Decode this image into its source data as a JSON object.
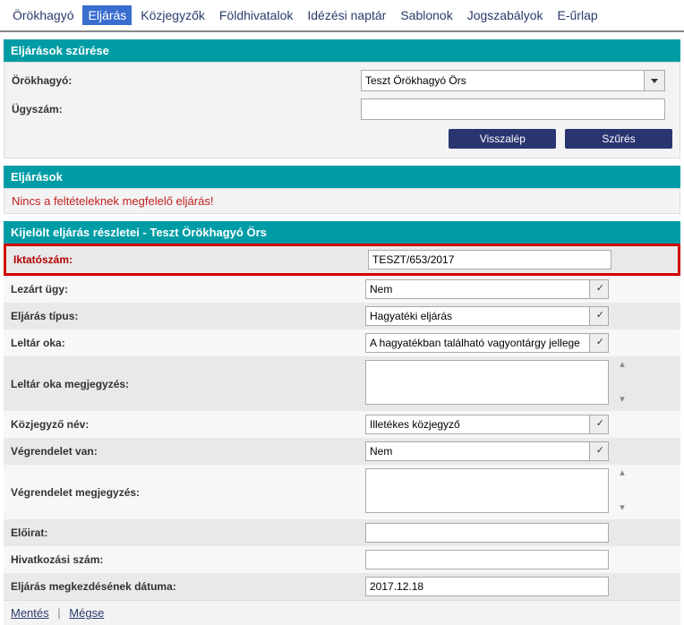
{
  "nav": {
    "items": [
      {
        "label": "Örökhagyó",
        "active": false
      },
      {
        "label": "Eljárás",
        "active": true
      },
      {
        "label": "Közjegyzők",
        "active": false
      },
      {
        "label": "Földhivatalok",
        "active": false
      },
      {
        "label": "Idézési naptár",
        "active": false
      },
      {
        "label": "Sablonok",
        "active": false
      },
      {
        "label": "Jogszabályok",
        "active": false
      },
      {
        "label": "E-űrlap",
        "active": false
      }
    ]
  },
  "filter": {
    "title": "Eljárások szűrése",
    "orokhagyo_label": "Örökhagyó:",
    "orokhagyo_value": "Teszt Örökhagyó Örs",
    "ugyszam_label": "Ügyszám:",
    "ugyszam_value": "",
    "btn_back": "Visszalép",
    "btn_filter": "Szűrés"
  },
  "list": {
    "title": "Eljárások",
    "empty_msg": "Nincs a feltételeknek megfelelő eljárás!"
  },
  "detail": {
    "title": "Kijelölt eljárás részletei - Teszt Örökhagyó Örs",
    "rows": {
      "iktatoszam_label": "Iktatószám:",
      "iktatoszam_value": "TESZT/653/2017",
      "lezart_label": "Lezárt ügy:",
      "lezart_value": "Nem",
      "tipus_label": "Eljárás típus:",
      "tipus_value": "Hagyatéki eljárás",
      "leltar_oka_label": "Leltár oka:",
      "leltar_oka_value": "A hagyatékban található vagyontárgy jellege",
      "leltar_megj_label": "Leltár oka megjegyzés:",
      "leltar_megj_value": "",
      "kozjegyzo_label": "Közjegyző név:",
      "kozjegyzo_value": "Illetékes közjegyző",
      "vegrendelet_label": "Végrendelet van:",
      "vegrendelet_value": "Nem",
      "vegrendelet_megj_label": "Végrendelet megjegyzés:",
      "vegrendelet_megj_value": "",
      "eloirat_label": "Előirat:",
      "eloirat_value": "",
      "hivatkozas_label": "Hivatkozási szám:",
      "hivatkozas_value": "",
      "datum_label": "Eljárás megkezdésének dátuma:",
      "datum_value": "2017.12.18"
    },
    "footer": {
      "save": "Mentés",
      "cancel": "Mégse"
    }
  }
}
